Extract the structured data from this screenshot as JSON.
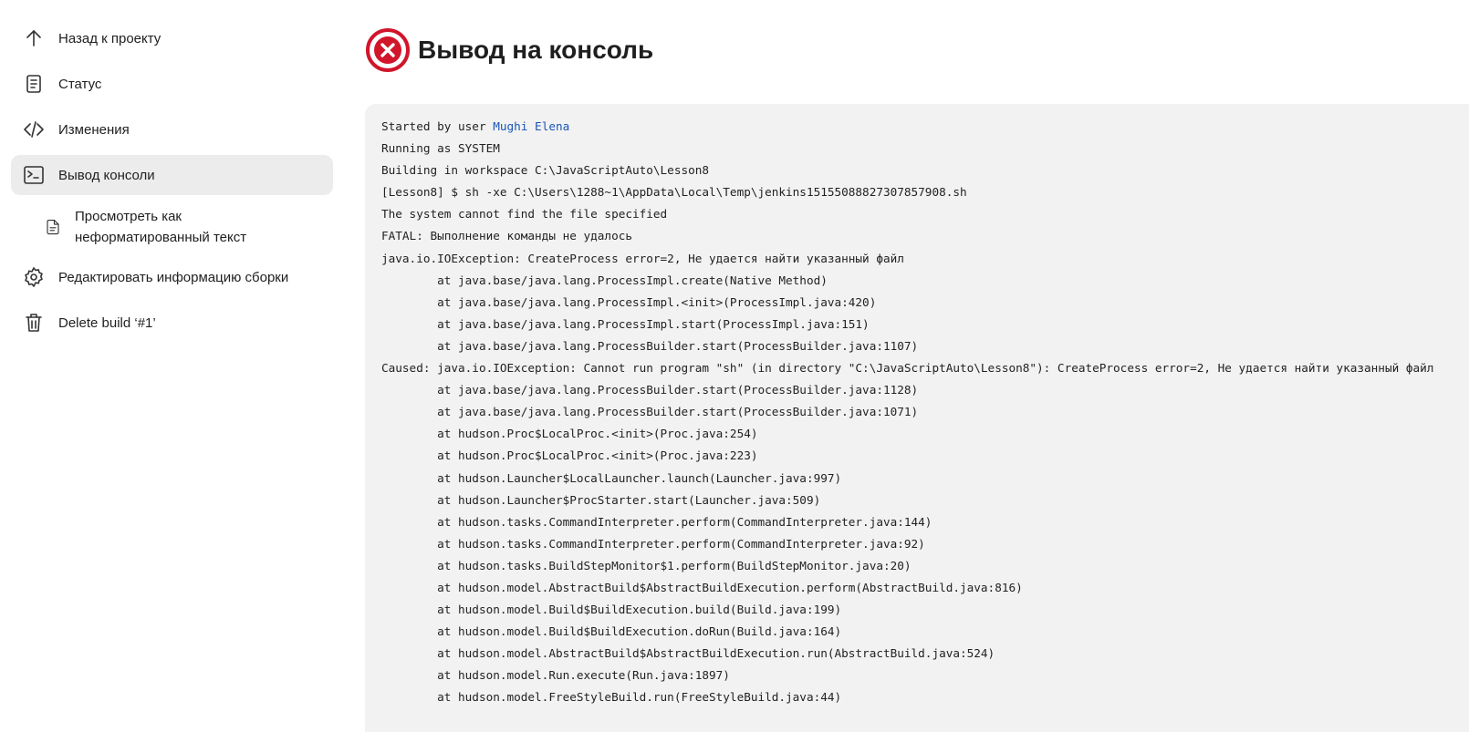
{
  "sidebar": {
    "items": [
      {
        "label": "Назад к проекту",
        "icon": "arrow-up-icon"
      },
      {
        "label": "Статус",
        "icon": "document-icon"
      },
      {
        "label": "Изменения",
        "icon": "code-icon"
      },
      {
        "label": "Вывод консоли",
        "icon": "terminal-icon",
        "active": true
      },
      {
        "label": "Редактировать информацию сборки",
        "icon": "gear-icon"
      },
      {
        "label": "Delete build ‘#1’",
        "icon": "trash-icon"
      }
    ],
    "subitem": {
      "label_line1": "Просмотреть как",
      "label_line2": "неформатированный текст",
      "icon": "file-icon"
    }
  },
  "header": {
    "title": "Вывод на консоль",
    "status_icon": "failure-icon",
    "status_color": "#d1152b"
  },
  "console": {
    "started_prefix": "Started by user ",
    "user_link": "Mughi Elena",
    "lines": [
      "Running as SYSTEM",
      "Building in workspace C:\\JavaScriptAuto\\Lesson8",
      "[Lesson8] $ sh -xe C:\\Users\\1288~1\\AppData\\Local\\Temp\\jenkins15155088827307857908.sh",
      "The system cannot find the file specified",
      "FATAL: Выполнение команды не удалось",
      "java.io.IOException: CreateProcess error=2, Не удается найти указанный файл",
      "        at java.base/java.lang.ProcessImpl.create(Native Method)",
      "        at java.base/java.lang.ProcessImpl.<init>(ProcessImpl.java:420)",
      "        at java.base/java.lang.ProcessImpl.start(ProcessImpl.java:151)",
      "        at java.base/java.lang.ProcessBuilder.start(ProcessBuilder.java:1107)",
      "Caused: java.io.IOException: Cannot run program \"sh\" (in directory \"C:\\JavaScriptAuto\\Lesson8\"): CreateProcess error=2, Не удается найти указанный файл",
      "        at java.base/java.lang.ProcessBuilder.start(ProcessBuilder.java:1128)",
      "        at java.base/java.lang.ProcessBuilder.start(ProcessBuilder.java:1071)",
      "        at hudson.Proc$LocalProc.<init>(Proc.java:254)",
      "        at hudson.Proc$LocalProc.<init>(Proc.java:223)",
      "        at hudson.Launcher$LocalLauncher.launch(Launcher.java:997)",
      "        at hudson.Launcher$ProcStarter.start(Launcher.java:509)",
      "        at hudson.tasks.CommandInterpreter.perform(CommandInterpreter.java:144)",
      "        at hudson.tasks.CommandInterpreter.perform(CommandInterpreter.java:92)",
      "        at hudson.tasks.BuildStepMonitor$1.perform(BuildStepMonitor.java:20)",
      "        at hudson.model.AbstractBuild$AbstractBuildExecution.perform(AbstractBuild.java:816)",
      "        at hudson.model.Build$BuildExecution.build(Build.java:199)",
      "        at hudson.model.Build$BuildExecution.doRun(Build.java:164)",
      "        at hudson.model.AbstractBuild$AbstractBuildExecution.run(AbstractBuild.java:524)",
      "        at hudson.model.Run.execute(Run.java:1897)",
      "        at hudson.model.FreeStyleBuild.run(FreeStyleBuild.java:44)"
    ]
  }
}
